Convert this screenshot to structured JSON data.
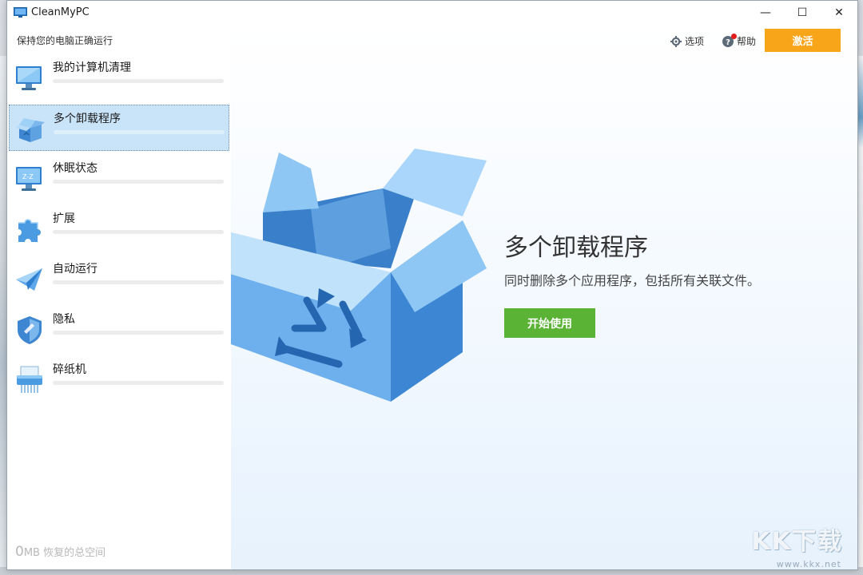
{
  "window": {
    "title": "CleanMyPC",
    "minimize_glyph": "—",
    "maximize_glyph": "☐",
    "close_glyph": "✕"
  },
  "sidebar": {
    "tagline": "保持您的电脑正确运行",
    "items": [
      {
        "label": "我的计算机清理",
        "icon": "monitor-icon",
        "active": false
      },
      {
        "label": "多个卸载程序",
        "icon": "box-icon",
        "active": true
      },
      {
        "label": "休眠状态",
        "icon": "sleep-monitor-icon",
        "active": false
      },
      {
        "label": "扩展",
        "icon": "puzzle-icon",
        "active": false
      },
      {
        "label": "自动运行",
        "icon": "paper-plane-icon",
        "active": false
      },
      {
        "label": "隐私",
        "icon": "shield-icon",
        "active": false
      },
      {
        "label": "碎纸机",
        "icon": "shredder-icon",
        "active": false
      }
    ],
    "reclaimed_value": "0",
    "reclaimed_unit": "MB",
    "reclaimed_label": "恢复的总空间"
  },
  "header": {
    "options_label": "选项",
    "help_label": "帮助",
    "activate_label": "激活"
  },
  "main": {
    "title": "多个卸载程序",
    "subtitle": "同时删除多个应用程序，包括所有关联文件。",
    "start_label": "开始使用"
  },
  "watermark": {
    "text": "KK下载",
    "url": "www.kkx.net"
  },
  "colors": {
    "activate": "#f9a51a",
    "start": "#5bb335",
    "active_item": "#c9e3f8",
    "accent_blue": "#4a90d9"
  }
}
